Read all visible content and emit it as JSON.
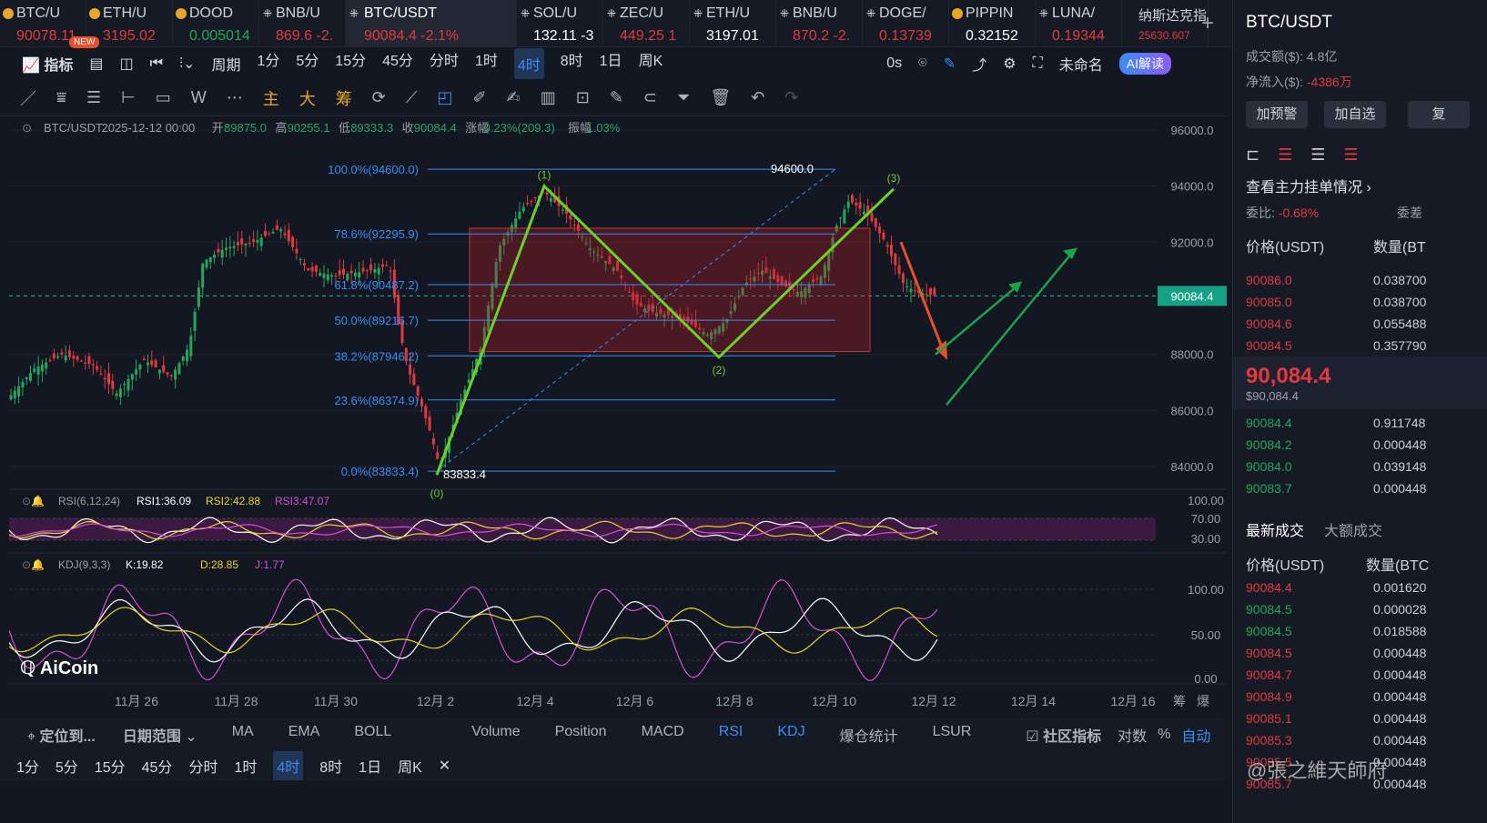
{
  "tabs": [
    {
      "name": "BTC/U",
      "price": "90078.11",
      "dir": "down",
      "icon": "bitcoin-icon"
    },
    {
      "name": "ETH/U",
      "price": "3195.02",
      "dir": "down",
      "icon": "eth-icon"
    },
    {
      "name": "DOOD",
      "price": "0.005014",
      "dir": "up",
      "icon": "dood-icon"
    },
    {
      "name": "BNB/U",
      "price": "869.6 -2.",
      "dir": "down",
      "icon": "exchange-icon"
    },
    {
      "name": "BTC/USDT",
      "price": "90084.4 -2.1%",
      "dir": "down",
      "icon": "exchange-icon",
      "active": true
    },
    {
      "name": "SOL/U",
      "price": "132.11 -3",
      "dir": "none",
      "icon": "exchange-icon"
    },
    {
      "name": "ZEC/U",
      "price": "449.25 1",
      "dir": "down",
      "icon": "exchange-icon"
    },
    {
      "name": "ETH/U",
      "price": "3197.01",
      "dir": "none",
      "icon": "exchange-icon"
    },
    {
      "name": "BNB/U",
      "price": "870.2 -2.",
      "dir": "down",
      "icon": "exchange-icon"
    },
    {
      "name": "DOGE/",
      "price": "0.13739",
      "dir": "down",
      "icon": "exchange-icon"
    },
    {
      "name": "PIPPIN",
      "price": "0.32152",
      "dir": "none",
      "icon": "pippin-icon"
    },
    {
      "name": "LUNA/",
      "price": "0.19344",
      "dir": "down",
      "icon": "exchange-icon"
    },
    {
      "name": "纳斯达克指",
      "price": "25630.607",
      "dir": "down",
      "icon": ""
    }
  ],
  "new_badge": "NEW",
  "toolbar1": {
    "indicators": "指标",
    "period": "周期",
    "intervals": [
      "1分",
      "5分",
      "15分",
      "45分",
      "分时",
      "1时",
      "4时",
      "8时",
      "1日",
      "周K"
    ],
    "active_interval": "4时",
    "countdown": "0s",
    "layout_name": "未命名",
    "ai_label": "AI解读"
  },
  "toolbar2": {
    "main": "主",
    "big": "大",
    "chip": "筹"
  },
  "chart_header": {
    "symbol": "BTC/USDT",
    "date": "2025-12-12 00:00",
    "open_label": "开",
    "open": "89875.0",
    "high_label": "高",
    "high": "90255.1",
    "low_label": "低",
    "low": "89333.3",
    "close_label": "收",
    "close": "90084.4",
    "change_label": "涨幅",
    "change": "0.23%(209.3)",
    "amp_label": "振幅",
    "amp": "1.03%"
  },
  "price_axis": [
    "96000.0",
    "94000.0",
    "92000.0",
    "90084.4",
    "88000.0",
    "86000.0",
    "84000.0"
  ],
  "fib": [
    {
      "label": "100.0%(94600.0)",
      "price": 94600
    },
    {
      "label": "78.6%(92295.9)",
      "price": 92295.9
    },
    {
      "label": "61.8%(90487.2)",
      "price": 90487.2
    },
    {
      "label": "50.0%(89216.7)",
      "price": 89216.7
    },
    {
      "label": "38.2%(87946.2)",
      "price": 87946.2
    },
    {
      "label": "23.6%(86374.9)",
      "price": 86374.9
    },
    {
      "label": "0.0%(83833.4)",
      "price": 83833.4
    }
  ],
  "annotations": {
    "high": "94600.0",
    "low": "83833.4",
    "wave1": "(1)",
    "wave2": "(2)",
    "wave3": "(3)",
    "wave0": "(0)"
  },
  "rsi": {
    "title": "RSI(6,12,24)",
    "r1": "RSI1:36.09",
    "r2": "RSI2:42.88",
    "r3": "RSI3:47.07",
    "axis": [
      "100.00",
      "70.00",
      "30.00"
    ]
  },
  "kdj": {
    "title": "KDJ(9,3,3)",
    "k": "K:19.82",
    "d": "D:28.85",
    "j": "J:1.77",
    "axis": [
      "100.00",
      "50.00",
      "0.00"
    ]
  },
  "x_axis": [
    "11月 26",
    "11月 28",
    "11月 30",
    "12月 2",
    "12月 4",
    "12月 6",
    "12月 8",
    "12月 10",
    "12月 12",
    "12月 14",
    "12月 16"
  ],
  "x_right": [
    "筹",
    "爆"
  ],
  "brand": "AiCoin",
  "bottom1": {
    "locate": "定位到...",
    "date_range": "日期范围",
    "items": [
      "MA",
      "EMA",
      "BOLL",
      "Volume",
      "Position",
      "MACD",
      "RSI",
      "KDJ",
      "爆仓统计",
      "LSUR"
    ],
    "active": [
      "RSI",
      "KDJ"
    ],
    "community": "社区指标",
    "log": "对数",
    "pct": "%",
    "auto": "自动"
  },
  "bottom2": {
    "intervals": [
      "1分",
      "5分",
      "15分",
      "45分",
      "分时",
      "1时",
      "4时",
      "8时",
      "1日",
      "周K"
    ],
    "active": "4时"
  },
  "right": {
    "title": "BTC/USDT",
    "turnover_label": "成交额($):",
    "turnover": "4.8亿",
    "inflow_label": "净流入($):",
    "inflow": "-4386万",
    "btn_alert": "加预警",
    "btn_fav": "加自选",
    "btn_more": "复",
    "depth_link": "查看主力挂单情况",
    "ratio_label": "委比:",
    "ratio": "-0.68%",
    "diff_label": "委差",
    "col_price": "价格(USDT)",
    "col_qty": "数量(BT",
    "asks": [
      [
        "90086.0",
        "0.038700"
      ],
      [
        "90085.0",
        "0.038700"
      ],
      [
        "90084.6",
        "0.055488"
      ],
      [
        "90084.5",
        "0.357790"
      ]
    ],
    "last": "90,084.4",
    "last_usd": "$90,084.4",
    "bids": [
      [
        "90084.4",
        "0.911748"
      ],
      [
        "90084.2",
        "0.000448"
      ],
      [
        "90084.0",
        "0.039148"
      ],
      [
        "90083.7",
        "0.000448"
      ]
    ],
    "trades_tab": "最新成交",
    "big_tab": "大额成交",
    "col_price2": "价格(USDT)",
    "col_qty2": "数量(BTC",
    "trades": [
      [
        "90084.4",
        "0.001620",
        "down"
      ],
      [
        "90084.5",
        "0.000028",
        "up"
      ],
      [
        "90084.5",
        "0.018588",
        "up"
      ],
      [
        "90084.5",
        "0.000448",
        "down"
      ],
      [
        "90084.7",
        "0.000448",
        "down"
      ],
      [
        "90084.9",
        "0.000448",
        "down"
      ],
      [
        "90085.1",
        "0.000448",
        "down"
      ],
      [
        "90085.3",
        "0.000448",
        "down"
      ],
      [
        "90085.5",
        "0.000448",
        "down"
      ],
      [
        "90085.7",
        "0.000448",
        "down"
      ]
    ]
  },
  "watermark": "@張之維天師府"
}
